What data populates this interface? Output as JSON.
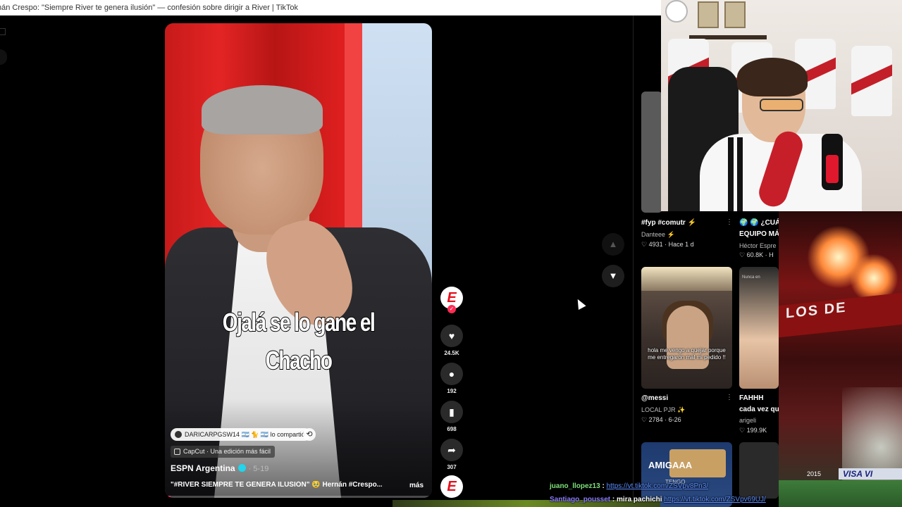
{
  "window": {
    "title": "nán Crespo: \"Siempre River te genera ilusión\" — confesión sobre dirigir a River | TikTok"
  },
  "video": {
    "caption_line1": "Ojalá se lo gane el",
    "caption_line2": "Chacho",
    "repost_user": "DARICARPGSW14 🇦🇷 🐈 🇦🇷",
    "repost_text": "lo compartió",
    "capcut_label": "CapCut · Una edición más fácil",
    "author": "ESPN Argentina",
    "date": "· 5-19",
    "description": "\"#RIVER SIEMPRE TE GENERA ILUSIÓN\" 🥹 Hernán #Crespo...",
    "more_label": "más",
    "progress": 0.02
  },
  "actions": {
    "avatar_letter": "E",
    "likes": "24.5K",
    "comments": "192",
    "saves": "698",
    "shares": "307",
    "sound_letter": "E"
  },
  "nav": {
    "up_icon": "chevron-up-icon",
    "down_icon": "chevron-down-icon"
  },
  "recommended": [
    {
      "title": "#fyp #comutr ⚡",
      "author": "Danteee ⚡",
      "likes": "4931",
      "time": "Hace 1 d"
    },
    {
      "title": "🌍 🌍 ¿CUÁ",
      "title2": "EQUIPO MÁ",
      "author": "Héctor Espre",
      "likes": "60.8K",
      "time": "H"
    },
    {
      "title": "@messi",
      "author": "LOCAL PJR ✨",
      "likes": "2784",
      "time": "6-26",
      "thumb_caption": "hola me vengo a quejar porque me entregaron mal mi pedido !!"
    },
    {
      "title": "FAHHH",
      "title2": "cada vez qu",
      "author": "arigeli",
      "likes": "199.9K",
      "time": "",
      "thumb_caption": "Nunca en"
    },
    {
      "thumb_title": "AMIGAAA",
      "thumb_sub": "TENGO"
    }
  ],
  "stadium": {
    "banner": "LOS DE",
    "sponsor": "VISA VI",
    "year": "2015"
  },
  "chat": [
    {
      "user": "juano_llopez13",
      "sep": " : ",
      "link": "https://vt.tiktok.com/ZSVpv8Pn3/"
    },
    {
      "user": "Santiago_pousset",
      "sep": " : ",
      "message": "mira pachichi ",
      "link": "https://vt.tiktok.com/ZSVpv69UJ/"
    }
  ],
  "colors": {
    "accent": "#fe2c55",
    "espn_red": "#e5101d",
    "chat_user1": "#7fe07a",
    "chat_user2": "#8a7cff"
  }
}
